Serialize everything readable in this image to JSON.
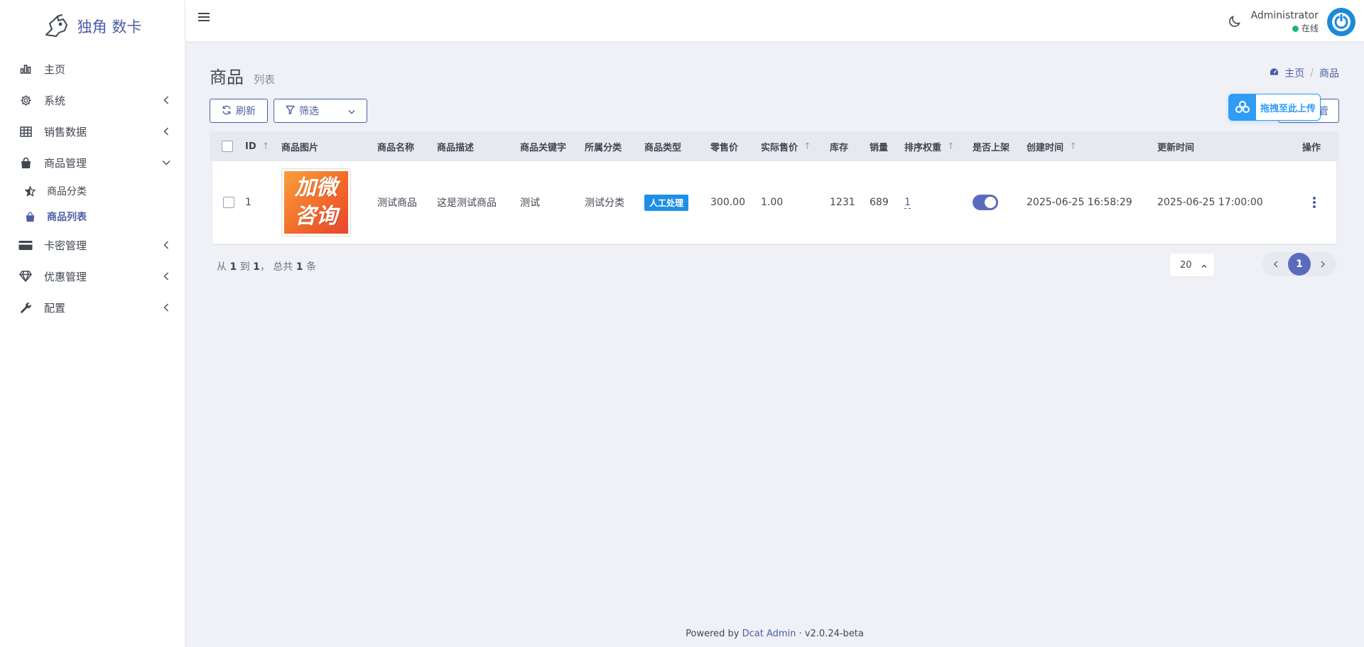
{
  "brand": {
    "name": "独角 数卡"
  },
  "sidebar": {
    "items": [
      {
        "label": "主页",
        "icon": "bar-chart-icon",
        "has_arrow": false
      },
      {
        "label": "系统",
        "icon": "gear-icon",
        "has_arrow": true
      },
      {
        "label": "销售数据",
        "icon": "grid-table-icon",
        "has_arrow": true
      },
      {
        "label": "商品管理",
        "icon": "shopping-bag-icon",
        "has_arrow": true,
        "expanded": true,
        "children": [
          {
            "label": "商品分类",
            "icon": "star-half-icon"
          },
          {
            "label": "商品列表",
            "icon": "shopping-bag-icon",
            "active": true
          }
        ]
      },
      {
        "label": "卡密管理",
        "icon": "credit-card-icon",
        "has_arrow": true
      },
      {
        "label": "优惠管理",
        "icon": "diamond-icon",
        "has_arrow": true
      },
      {
        "label": "配置",
        "icon": "wrench-icon",
        "has_arrow": true
      }
    ]
  },
  "topbar": {
    "user_name": "Administrator",
    "user_status": "在线"
  },
  "page": {
    "title": "商品",
    "subtitle": "列表",
    "breadcrumb": {
      "home": "主页",
      "current": "商品"
    }
  },
  "toolbar": {
    "refresh_label": "刷新",
    "filter_label": "筛选",
    "hidden_btn_label": "管",
    "upload_label": "拖拽至此上传"
  },
  "table": {
    "headers": {
      "id": "ID",
      "image": "商品图片",
      "name": "商品名称",
      "desc": "商品描述",
      "keywords": "商品关键字",
      "category": "所属分类",
      "type": "商品类型",
      "retail": "零售价",
      "actual": "实际售价",
      "stock": "库存",
      "sales": "销量",
      "sort": "排序权重",
      "on_sale": "是否上架",
      "created": "创建时间",
      "updated": "更新时间",
      "ops": "操作"
    },
    "rows": [
      {
        "id": "1",
        "image_text_1": "加微",
        "image_text_2": "咨询",
        "name": "测试商品",
        "desc": "这是测试商品",
        "keywords": "测试",
        "category": "测试分类",
        "type": "人工处理",
        "retail": "300.00",
        "actual": "1.00",
        "stock": "1231",
        "sales": "689",
        "sort": "1",
        "on_sale": true,
        "created": "2025-06-25 16:58:29",
        "updated": "2025-06-25 17:00:00"
      }
    ]
  },
  "summary": {
    "prefix": "从",
    "from": "1",
    "to_word": "到",
    "to": "1",
    "total_word": "， 总共",
    "total": "1",
    "unit": "条"
  },
  "pagination": {
    "per_page": "20",
    "current": "1"
  },
  "footer": {
    "prefix": "Powered by",
    "link": "Dcat Admin",
    "sep": "·",
    "version": "v2.0.24-beta"
  },
  "colors": {
    "primary": "#4d5ea5",
    "badge": "#1f8fe5",
    "online": "#21b978",
    "upload": "#2f9cf5"
  }
}
